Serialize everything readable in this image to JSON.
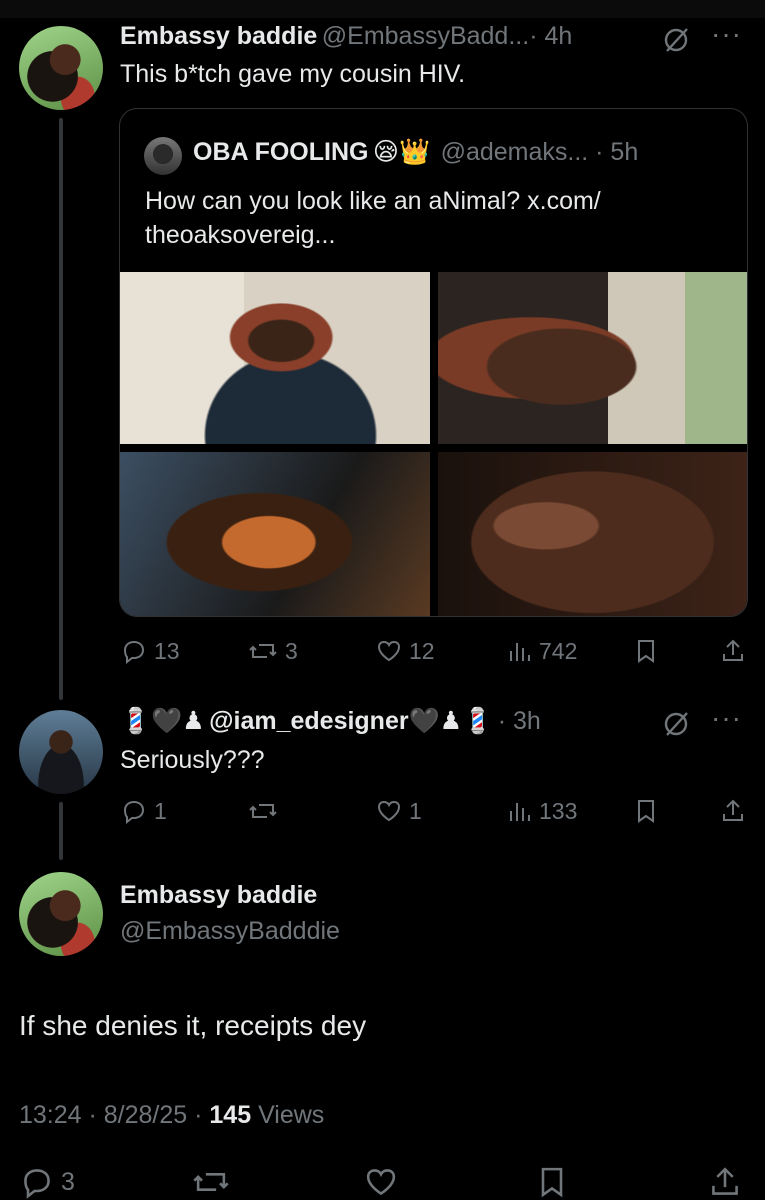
{
  "tweet1": {
    "name": "Embassy baddie",
    "handle": "@EmbassyBadd...",
    "time": "· 4h",
    "text": "This b*tch gave my cousin HIV."
  },
  "quote": {
    "name": "OBA FOOLING",
    "emoji": "😪👑",
    "handle": "@ademaks... · 5h",
    "text_line1": "How can you look like an aNimal? x.com/",
    "text_line2": "theoaksovereig...",
    "images": [
      "photo-1",
      "photo-2",
      "photo-3",
      "photo-4"
    ]
  },
  "tweet1_actions": {
    "replies": "13",
    "reposts": "3",
    "likes": "12",
    "views": "742"
  },
  "tweet2": {
    "name_prefix": "💈🖤♟",
    "handle": "@iam_edesigner",
    "name_suffix": "🖤♟💈",
    "time": "· 3h",
    "text": "Seriously???"
  },
  "tweet2_actions": {
    "replies": "1",
    "reposts": "",
    "likes": "1",
    "views": "133"
  },
  "main": {
    "name": "Embassy baddie",
    "handle": "@EmbassyBadddie",
    "text": "If she denies it, receipts dey",
    "timestamp": "13:24 · 8/28/25 · ",
    "views_count": "145",
    "views_label": " Views"
  },
  "main_actions": {
    "replies": "3"
  },
  "colors": {
    "background": "#000000",
    "text": "#e7e9ea",
    "muted": "#71767b",
    "border": "#2f3336"
  }
}
